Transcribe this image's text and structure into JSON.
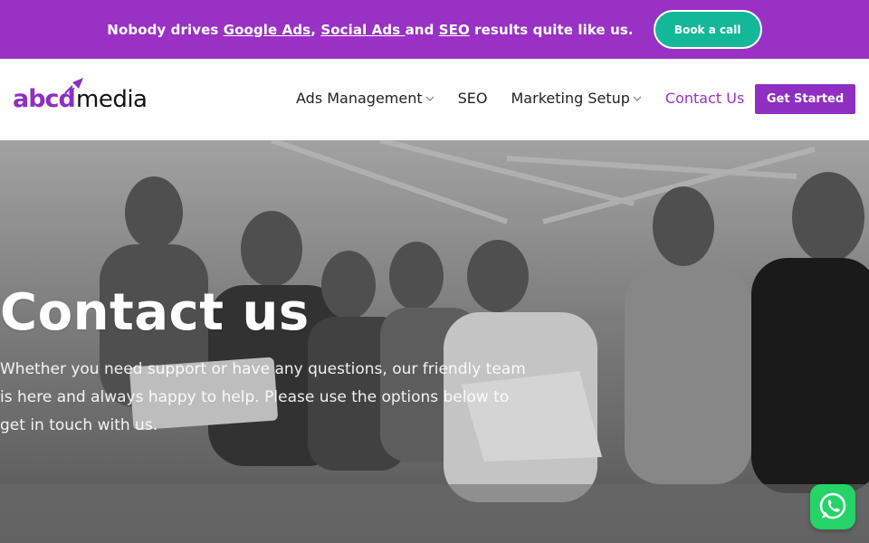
{
  "promo": {
    "text_before": "Nobody drives ",
    "link_google": "Google Ads",
    "sep1": ", ",
    "link_social": "Social Ads ",
    "and": "and ",
    "link_seo": "SEO",
    "text_after": " results quite like us.",
    "button_label": "Book a call"
  },
  "brand": {
    "logo_part1": "abcd",
    "logo_part2": "media",
    "accent_color": "#9932c4",
    "button_green": "#14b899"
  },
  "nav": {
    "items": [
      {
        "label": "Ads Management",
        "has_dropdown": true
      },
      {
        "label": "SEO",
        "has_dropdown": false
      },
      {
        "label": "Marketing Setup",
        "has_dropdown": true
      },
      {
        "label": "Contact Us",
        "has_dropdown": false,
        "active": true
      }
    ],
    "cta_label": "Get Started"
  },
  "hero": {
    "title": "Contact us",
    "description": "Whether you need support or have any questions, our friendly team is here and always happy to help. Please use the options below to get in touch with us."
  },
  "icons": {
    "whatsapp": "whatsapp-icon",
    "chevron": "chevron-down-icon",
    "rocket": "rocket-icon"
  }
}
